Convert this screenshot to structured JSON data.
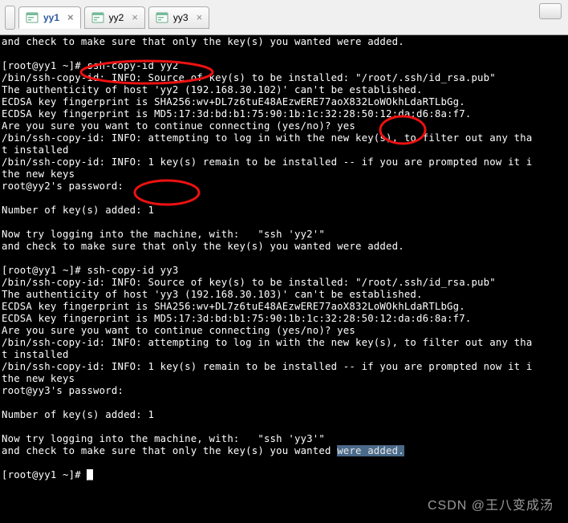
{
  "tabs": [
    {
      "label": "yy1",
      "active": true
    },
    {
      "label": "yy2",
      "active": false
    },
    {
      "label": "yy3",
      "active": false
    }
  ],
  "terminal": {
    "lines": [
      "and check to make sure that only the key(s) you wanted were added.",
      "",
      "[root@yy1 ~]# ssh-copy-id yy2",
      "/bin/ssh-copy-id: INFO: Source of key(s) to be installed: \"/root/.ssh/id_rsa.pub\"",
      "The authenticity of host 'yy2 (192.168.30.102)' can't be established.",
      "ECDSA key fingerprint is SHA256:wv+DL7z6tuE48AEzwERE77aoX832LoWOkhLdaRTLbGg.",
      "ECDSA key fingerprint is MD5:17:3d:bd:b1:75:90:1b:1c:32:28:50:12:da:d6:8a:f7.",
      "Are you sure you want to continue connecting (yes/no)? yes",
      "/bin/ssh-copy-id: INFO: attempting to log in with the new key(s), to filter out any tha",
      "t installed",
      "/bin/ssh-copy-id: INFO: 1 key(s) remain to be installed -- if you are prompted now it i",
      "the new keys",
      "root@yy2's password:",
      "",
      "Number of key(s) added: 1",
      "",
      "Now try logging into the machine, with:   \"ssh 'yy2'\"",
      "and check to make sure that only the key(s) you wanted were added.",
      "",
      "[root@yy1 ~]# ssh-copy-id yy3",
      "/bin/ssh-copy-id: INFO: Source of key(s) to be installed: \"/root/.ssh/id_rsa.pub\"",
      "The authenticity of host 'yy3 (192.168.30.103)' can't be established.",
      "ECDSA key fingerprint is SHA256:wv+DL7z6tuE48AEzwERE77aoX832LoWOkhLdaRTLbGg.",
      "ECDSA key fingerprint is MD5:17:3d:bd:b1:75:90:1b:1c:32:28:50:12:da:d6:8a:f7.",
      "Are you sure you want to continue connecting (yes/no)? yes",
      "/bin/ssh-copy-id: INFO: attempting to log in with the new key(s), to filter out any tha",
      "t installed",
      "/bin/ssh-copy-id: INFO: 1 key(s) remain to be installed -- if you are prompted now it i",
      "the new keys",
      "root@yy3's password:",
      "",
      "Number of key(s) added: 1",
      "",
      "Now try logging into the machine, with:   \"ssh 'yy3'\""
    ],
    "last_line_prefix": "and check to make sure that only the key(s) you wanted ",
    "last_line_selected": "were added.",
    "prompt": "[root@yy1 ~]# ",
    "cursor": "_"
  },
  "watermark": "CSDN @王八变成汤",
  "annotations": {
    "color": "#e11",
    "stroke_width": 3
  }
}
